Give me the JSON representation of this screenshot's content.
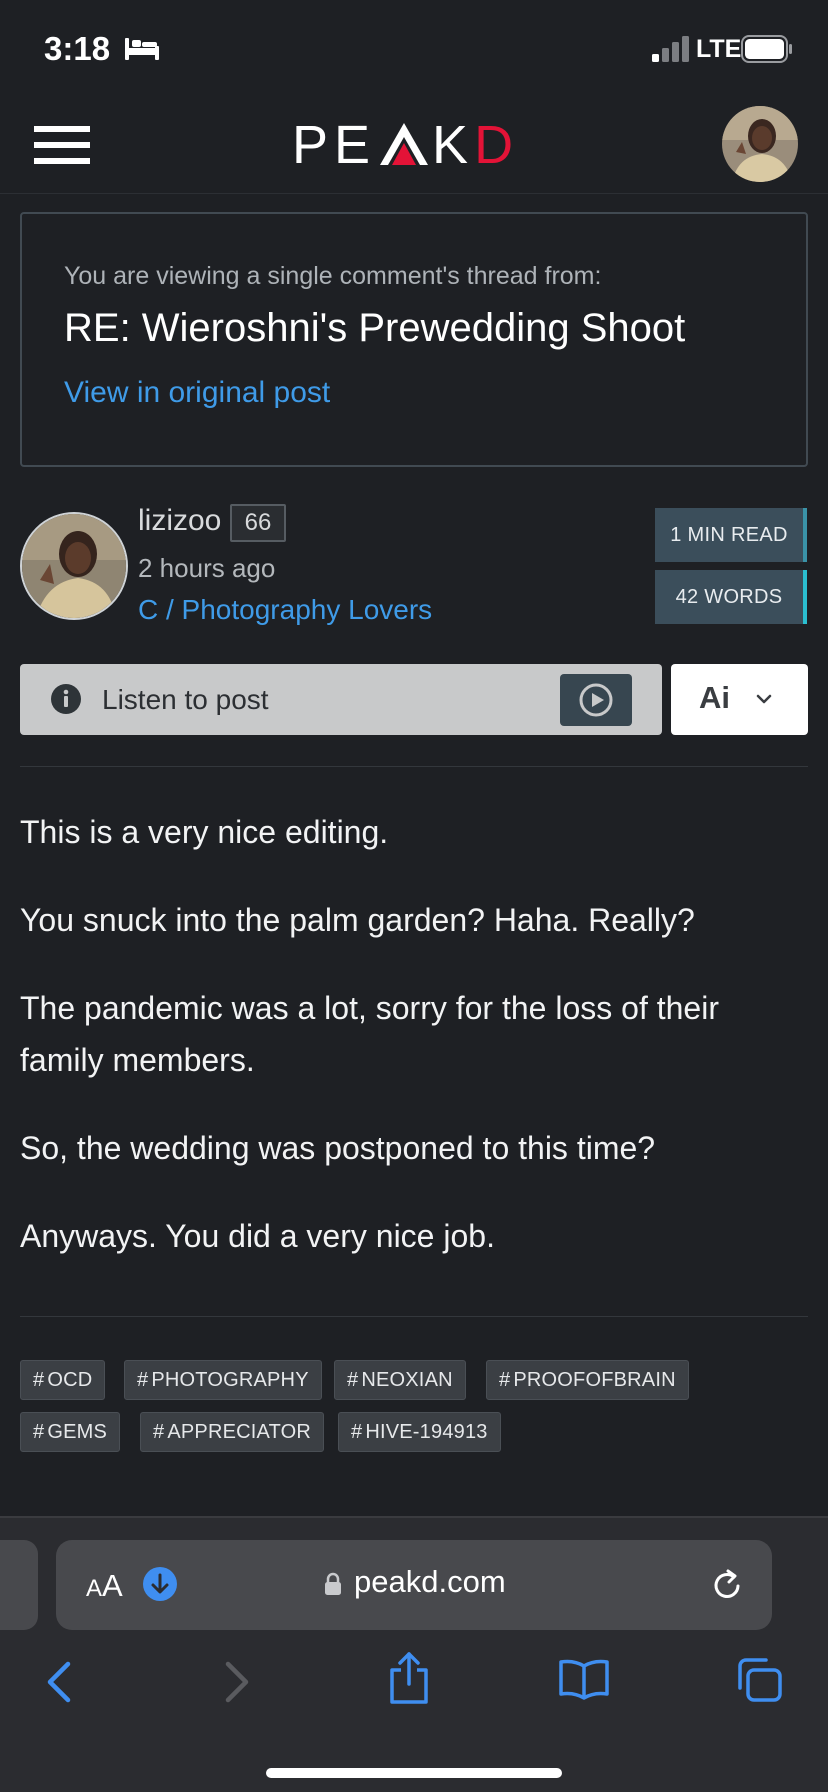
{
  "status_bar": {
    "time": "3:18",
    "network": "LTE"
  },
  "header": {
    "logo_left": "PE",
    "logo_right": "K",
    "logo_d": "D"
  },
  "thread": {
    "intro": "You are viewing a single comment's thread from:",
    "title": "RE: Wieroshni's Prewedding Shoot",
    "link_label": "View in original post"
  },
  "author": {
    "name": "lizizoo",
    "reputation": "66",
    "time": "2 hours ago",
    "community": "C / Photography Lovers"
  },
  "read_stats": {
    "minutes": "1 MIN READ",
    "words": "42 WORDS"
  },
  "listen": {
    "label": "Listen to post",
    "ai_label": "Ai"
  },
  "post": {
    "paragraphs": [
      "This is a very nice editing.",
      "You snuck into the palm garden? Haha. Really?",
      "The pandemic was a lot, sorry for the loss of their family members.",
      "So, the wedding was postponed to this time?",
      "Anyways. You did a very nice job."
    ]
  },
  "tags": [
    "OCD",
    "PHOTOGRAPHY",
    "NEOXIAN",
    "PROOFOFBRAIN",
    "GEMS",
    "APPRECIATOR",
    "HIVE-194913"
  ],
  "browser": {
    "aa_small": "A",
    "aa_large": "A",
    "url": "peakd.com"
  },
  "colors": {
    "accent": "#3f9be8",
    "brand_red": "#e31337",
    "background": "#1e2024"
  }
}
